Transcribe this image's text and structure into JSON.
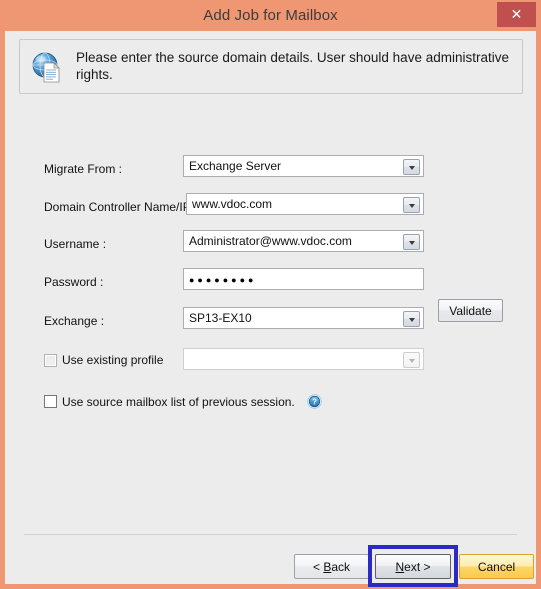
{
  "window": {
    "title": "Add Job for Mailbox",
    "close_label": "✕",
    "accent_titlebar": "#ef9672",
    "accent_close": "#c0504d",
    "client_bg": "#ececec"
  },
  "banner": {
    "icon": "globe-document-icon",
    "text": "Please enter the source domain details. User should have administrative rights."
  },
  "form": {
    "migrate_from": {
      "label": "Migrate From :",
      "value": "Exchange Server"
    },
    "domain_controller": {
      "label": "Domain Controller Name/IP :",
      "value": "www.vdoc.com"
    },
    "username": {
      "label": "Username :",
      "value": "Administrator@www.vdoc.com"
    },
    "password": {
      "label": "Password :",
      "value": "●●●●●●●●",
      "validate_label": "Validate"
    },
    "exchange": {
      "label": "Exchange :",
      "value": "SP13-EX10"
    },
    "use_existing_profile": {
      "label": "Use existing profile",
      "checked": false,
      "enabled": false,
      "profile_value": ""
    },
    "use_previous_session": {
      "label": "Use source mailbox list of previous session.",
      "checked": false,
      "help_icon": "question-mark-help-icon"
    }
  },
  "footer": {
    "back_label": "< Back",
    "back_accesskey": "B",
    "next_label": "Next >",
    "next_accesskey": "N",
    "cancel_label": "Cancel",
    "highlight_color": "#2b2bc4"
  }
}
